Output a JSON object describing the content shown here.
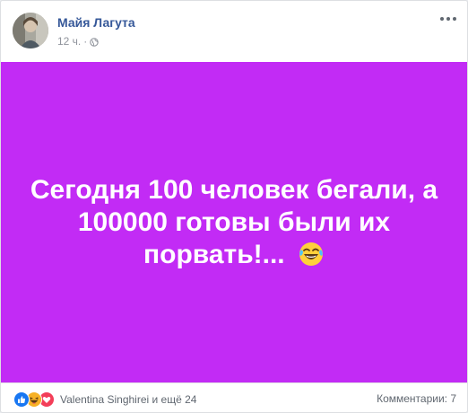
{
  "post": {
    "author": "Майя Лагута",
    "time": "12 ч.",
    "separator": "·",
    "privacy_icon": "globe-icon",
    "menu_icon": "more-options-icon",
    "text": "Сегодня 100 человек бегали, а 100000 готовы были их порвать!...",
    "emoji": "laughing-tears-emoji",
    "background_color": "#c22bf5"
  },
  "footer": {
    "reactions": [
      "like-icon",
      "haha-icon",
      "love-icon"
    ],
    "reactors_text": "Valentina Singhirei и ещё 24",
    "comments_text": "Комментарии: 7"
  },
  "colors": {
    "author_link": "#365899",
    "muted": "#90949c",
    "like": "#1877f2",
    "haha": "#f7b125",
    "love": "#f33e58"
  }
}
